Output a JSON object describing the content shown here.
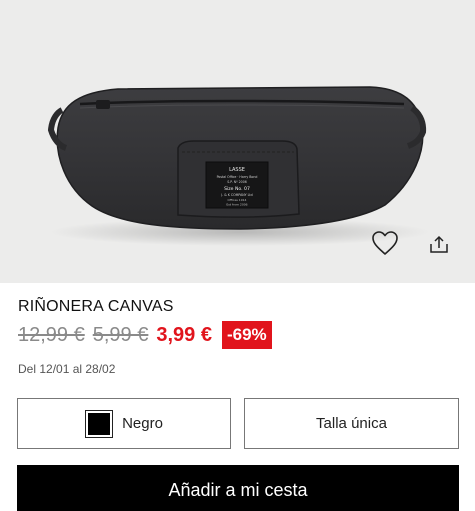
{
  "product": {
    "title": "RIÑONERA CANVAS",
    "original_price": "12,99 €",
    "previous_price": "5,99 €",
    "current_price": "3,99 €",
    "discount": "-69%",
    "dates": "Del 12/01 al 28/02",
    "image_label": {
      "brand": "LASSE",
      "line1": "Postal Office · Harry Bond",
      "line2": "S.P. Nº 2006",
      "line3": "Size No. 07",
      "line4": "J. & K COMPANY Ltd",
      "line5": "Offices 1914",
      "line6": "Est from 2006"
    }
  },
  "actions": {
    "favorite_icon": "heart-outline-icon",
    "share_icon": "share-icon"
  },
  "selectors": {
    "color_label": "Negro",
    "color_swatch": "#000000",
    "size_label": "Talla única"
  },
  "cta": {
    "add_to_cart_label": "Añadir a mi cesta"
  },
  "colors": {
    "sale_red": "#e1141c",
    "old_price_gray": "#8a8a8a",
    "button_black": "#000000",
    "hero_bg": "#ececeb"
  }
}
